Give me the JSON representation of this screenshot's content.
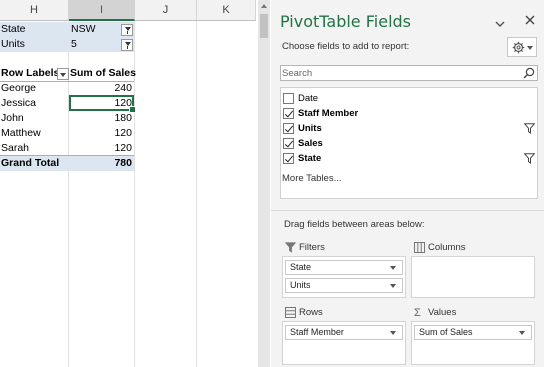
{
  "sheet": {
    "columns": [
      "H",
      "I",
      "J",
      "K"
    ],
    "selected_column": "I",
    "filters": [
      {
        "field": "State",
        "value": "NSW"
      },
      {
        "field": "Units",
        "value": "5"
      }
    ],
    "pivot": {
      "row_labels_header": "Row Labels",
      "values_header": "Sum of Sales",
      "rows": [
        {
          "label": "George",
          "value": "240"
        },
        {
          "label": "Jessica",
          "value": "120"
        },
        {
          "label": "John",
          "value": "180"
        },
        {
          "label": "Matthew",
          "value": "120"
        },
        {
          "label": "Sarah",
          "value": "120"
        }
      ],
      "grand_total_label": "Grand Total",
      "grand_total_value": "780"
    },
    "selected_cell": "I6"
  },
  "pane": {
    "title": "PivotTable Fields",
    "choose_label": "Choose fields to add to report:",
    "search_placeholder": "Search",
    "fields": [
      {
        "label": "Date",
        "checked": false,
        "filtered": false
      },
      {
        "label": "Staff Member",
        "checked": true,
        "filtered": false
      },
      {
        "label": "Units",
        "checked": true,
        "filtered": true
      },
      {
        "label": "Sales",
        "checked": true,
        "filtered": false
      },
      {
        "label": "State",
        "checked": true,
        "filtered": true
      }
    ],
    "more_tables": "More Tables...",
    "drag_label": "Drag fields between areas below:",
    "areas": {
      "filters": {
        "label": "Filters",
        "items": [
          "State",
          "Units"
        ]
      },
      "columns": {
        "label": "Columns",
        "items": []
      },
      "rows": {
        "label": "Rows",
        "items": [
          "Staff Member"
        ]
      },
      "values": {
        "label": "Values",
        "items": [
          "Sum of Sales"
        ]
      }
    },
    "colors": {
      "accent": "#217346",
      "pivot_band": "#dce6f1"
    }
  }
}
